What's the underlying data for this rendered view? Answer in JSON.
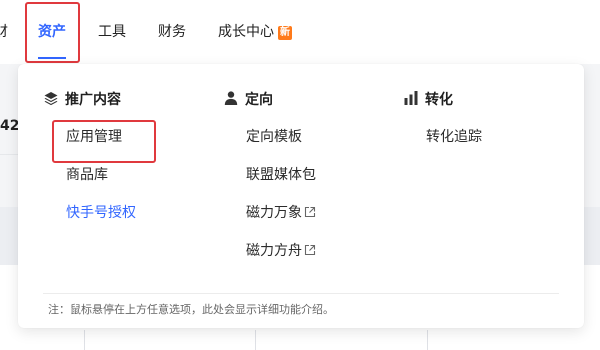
{
  "nav": {
    "cut_label": "财",
    "items": [
      {
        "label": "资产"
      },
      {
        "label": "工具"
      },
      {
        "label": "财务"
      },
      {
        "label": "成长中心"
      }
    ],
    "new_badge": "新",
    "active_color": "#3266ff",
    "badge_color": "#ff7a1a"
  },
  "background": {
    "left_number": "42"
  },
  "dropdown": {
    "columns": [
      {
        "title": "推广内容",
        "icon": "layers-icon",
        "items": [
          {
            "label": "应用管理"
          },
          {
            "label": "商品库"
          },
          {
            "label": "快手号授权"
          }
        ]
      },
      {
        "title": "定向",
        "icon": "user-icon",
        "items": [
          {
            "label": "定向模板"
          },
          {
            "label": "联盟媒体包"
          },
          {
            "label": "磁力万象"
          },
          {
            "label": "磁力方舟"
          }
        ]
      },
      {
        "title": "转化",
        "icon": "bar-chart-icon",
        "items": [
          {
            "label": "转化追踪"
          }
        ]
      }
    ],
    "footer_note": "注：鼠标悬停在上方任意选项，此处会显示详细功能介绍。"
  },
  "colors": {
    "link": "#3266ff",
    "highlight_box": "#e0393e"
  }
}
